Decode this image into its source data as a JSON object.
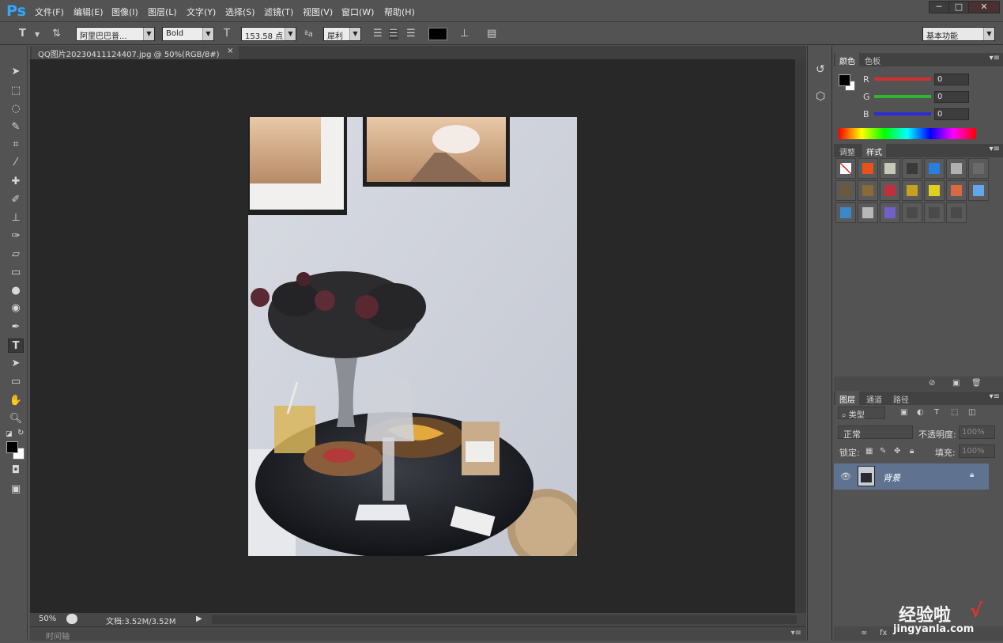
{
  "app": {
    "logo": "Ps"
  },
  "menu": [
    "文件(F)",
    "编辑(E)",
    "图像(I)",
    "图层(L)",
    "文字(Y)",
    "选择(S)",
    "滤镜(T)",
    "视图(V)",
    "窗口(W)",
    "帮助(H)"
  ],
  "window_controls": {
    "minimize": "─",
    "maximize": "□",
    "close": "✕"
  },
  "options_bar": {
    "tool_glyph": "T",
    "font_family": "阿里巴巴普...",
    "font_style": "Bold",
    "font_size": "153.58 点",
    "aa_glyph": "ªa",
    "antialias": "犀利",
    "color": "#000000",
    "workspace": "基本功能"
  },
  "document": {
    "tab_title": "QQ图片20230411124407.jpg @ 50%(RGB/8#)",
    "tab_close": "×"
  },
  "status": {
    "zoom": "50%",
    "doc_info": "文档:3.52M/3.52M"
  },
  "timeline": {
    "label": "时间轴"
  },
  "color_panel": {
    "tabs": [
      "颜色",
      "色板"
    ],
    "channels": [
      {
        "label": "R",
        "value": "0",
        "color": "#d23030"
      },
      {
        "label": "G",
        "value": "0",
        "color": "#29b82f"
      },
      {
        "label": "B",
        "value": "0",
        "color": "#2c2cd2"
      }
    ]
  },
  "styles_panel": {
    "tabs": [
      "调整",
      "样式"
    ],
    "swatch_colors": [
      "#ffffff",
      "#e8531c",
      "#c8c8b8",
      "#3a3a3a",
      "#2a7de1",
      "#b0b0b0",
      "#6a6a6a",
      "#6b5a3a",
      "#8a6a3a",
      "#c0303a",
      "#c8a020",
      "#e0d020",
      "#d86a40",
      "#60a8e8",
      "#3a88c8",
      "#b8b8b8",
      "#7060c8",
      "#4a4a4a",
      "#4a4a4a",
      "#4a4a4a"
    ]
  },
  "layers_panel": {
    "tabs": [
      "图层",
      "通道",
      "路径"
    ],
    "filter_label": "类型",
    "blend_mode": "正常",
    "opacity_label": "不透明度:",
    "opacity_value": "100%",
    "lock_label": "锁定:",
    "fill_label": "填充:",
    "fill_value": "100%",
    "layers": [
      {
        "name": "背景",
        "locked": true,
        "visible": true
      }
    ]
  },
  "watermark": {
    "text": "经验啦",
    "url": "jingyanla.com"
  }
}
